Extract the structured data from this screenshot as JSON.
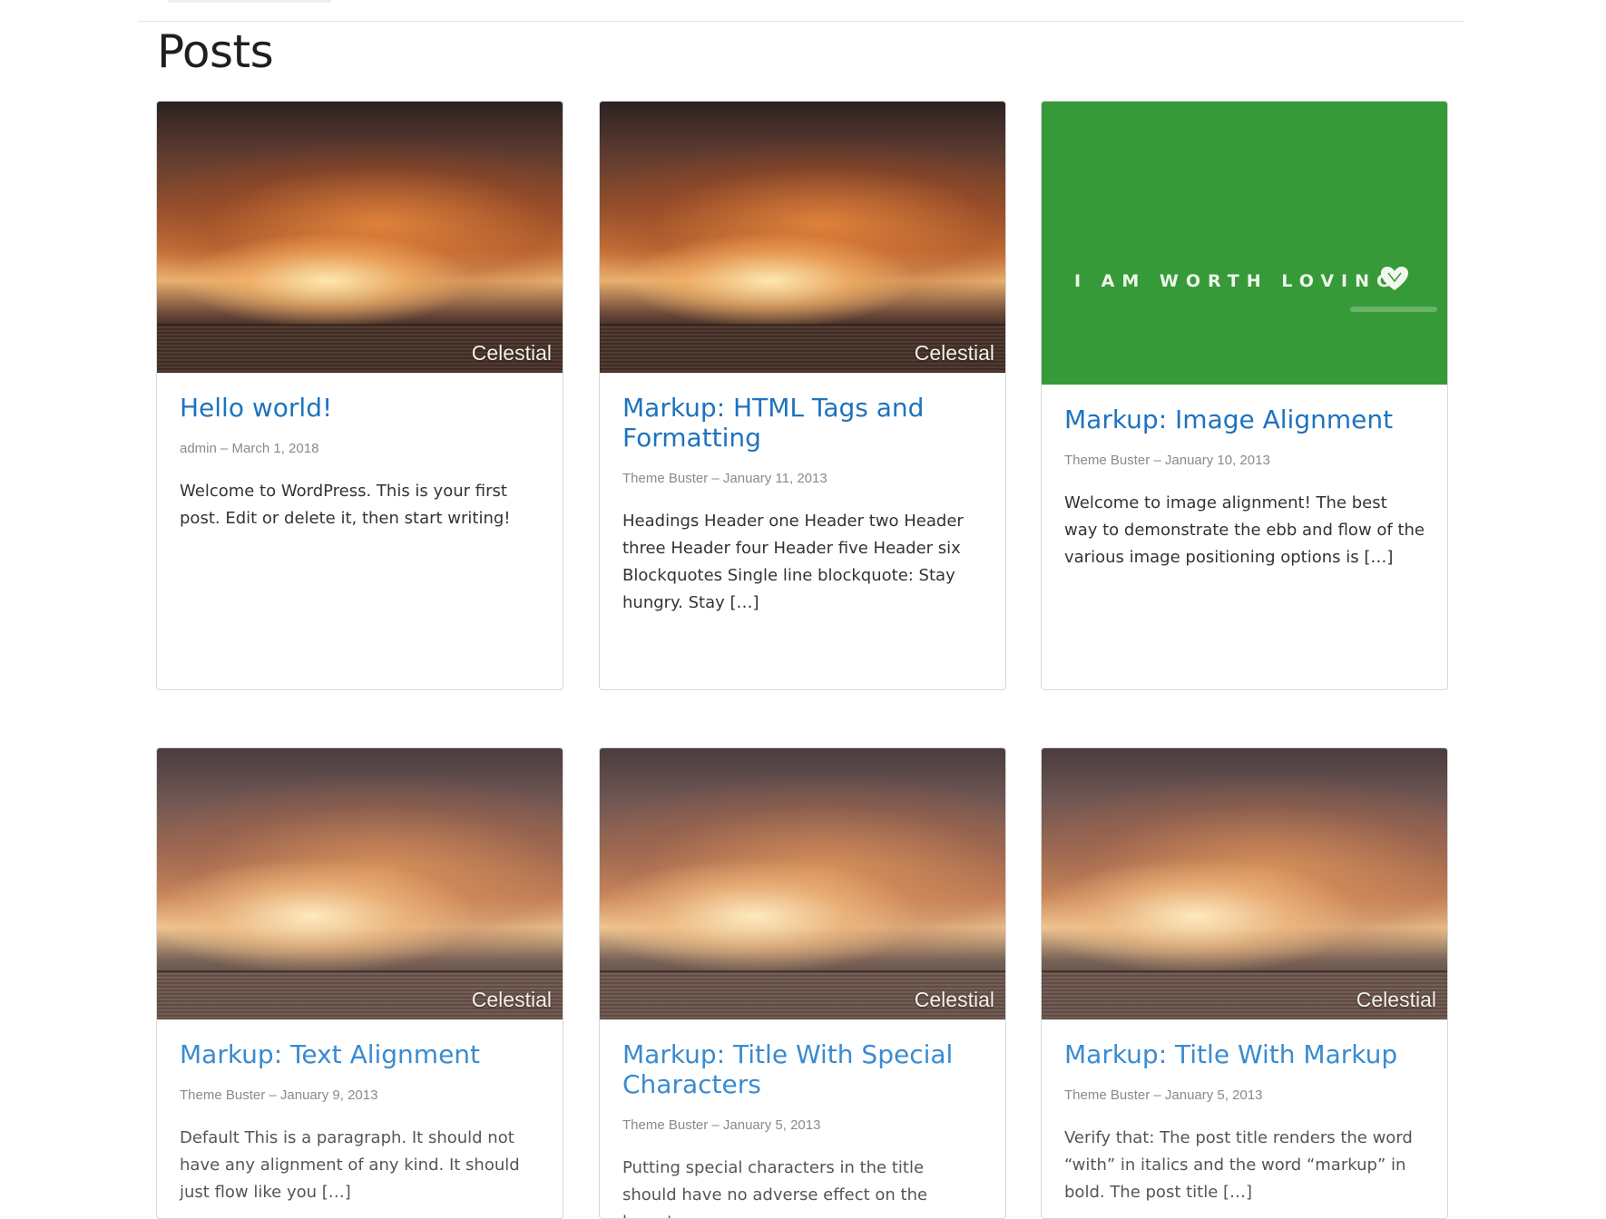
{
  "page": {
    "title": "Posts"
  },
  "posts": [
    {
      "thumb_type": "photo",
      "caption": "Celestial",
      "title": "Hello world!",
      "meta": "admin – March 1, 2018",
      "excerpt": "Welcome to WordPress. This is your first post. Edit or delete it, then start writing!"
    },
    {
      "thumb_type": "photo",
      "caption": "Celestial",
      "title": "Markup: HTML Tags and Formatting",
      "meta": "Theme Buster – January 11, 2013",
      "excerpt": "Headings Header one Header two Header three Header four Header five Header six Blockquotes Single line blockquote: Stay hungry. Stay […]"
    },
    {
      "thumb_type": "banner",
      "banner_text": "I AM WORTH LOVING",
      "banner_color": "#369a38",
      "title": "Markup: Image Alignment",
      "meta": "Theme Buster – January 10, 2013",
      "excerpt": "Welcome to image alignment! The best way to demonstrate the ebb and flow of the various image positioning options is […]"
    },
    {
      "thumb_type": "photo",
      "caption": "Celestial",
      "title": "Markup: Text Alignment",
      "meta": "Theme Buster – January 9, 2013",
      "excerpt": "Default This is a paragraph. It should not have any alignment of any kind. It should just flow like you […]"
    },
    {
      "thumb_type": "photo",
      "caption": "Celestial",
      "title": "Markup: Title With Special Characters",
      "meta": "Theme Buster – January 5, 2013",
      "excerpt": "Putting special characters in the title should have no adverse effect on the layout or"
    },
    {
      "thumb_type": "photo",
      "caption": "Celestial",
      "title": "Markup: Title With Markup",
      "meta": "Theme Buster – January 5, 2013",
      "excerpt": "Verify that: The post title renders the word “with” in italics and the word “markup” in bold. The post title […]"
    }
  ],
  "colors": {
    "link": "#1e73be",
    "meta": "#8a8a8a",
    "text": "#333333",
    "border": "#d9d9d9"
  },
  "icons": {
    "banner_icon": "heart-icon"
  }
}
